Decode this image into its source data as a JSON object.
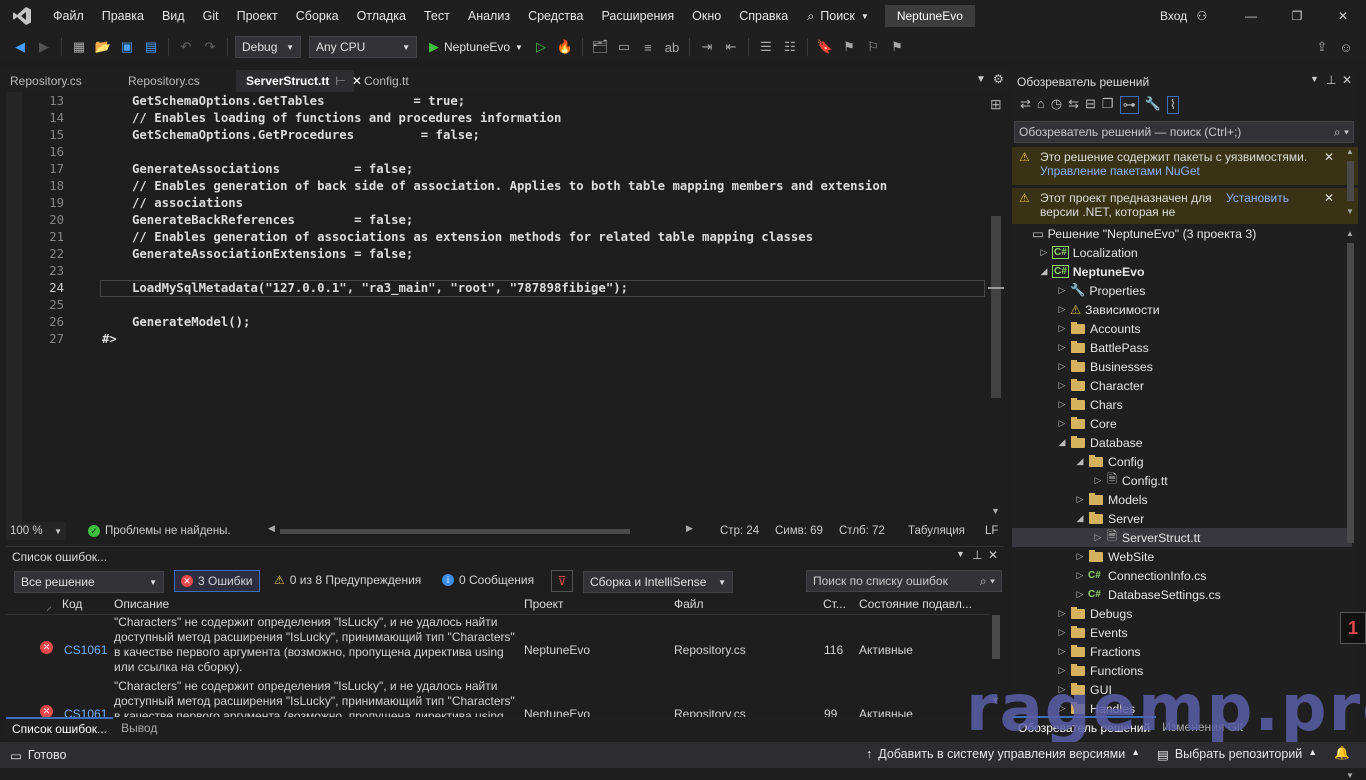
{
  "menu": [
    "Файл",
    "Правка",
    "Вид",
    "Git",
    "Проект",
    "Сборка",
    "Отладка",
    "Тест",
    "Анализ",
    "Средства",
    "Расширения",
    "Окно",
    "Справка"
  ],
  "search_label": "Поиск",
  "project_name": "NeptuneEvo",
  "login": "Вход",
  "toolbar": {
    "config": "Debug",
    "platform": "Any CPU",
    "run_label": "NeptuneEvo"
  },
  "tabs": [
    "Repository.cs",
    "Repository.cs",
    "ServerStruct.tt",
    "Config.tt"
  ],
  "code": [
    {
      "n": "13",
      "t": "GetSchemaOptions.GetTables            = true;"
    },
    {
      "n": "14",
      "t": "// Enables loading of functions and procedures information"
    },
    {
      "n": "15",
      "t": "GetSchemaOptions.GetProcedures         = false;"
    },
    {
      "n": "16",
      "t": ""
    },
    {
      "n": "17",
      "t": "GenerateAssociations          = false;"
    },
    {
      "n": "18",
      "t": "// Enables generation of back side of association. Applies to both table mapping members and extension"
    },
    {
      "n": "19",
      "t": "// associations"
    },
    {
      "n": "20",
      "t": "GenerateBackReferences        = false;"
    },
    {
      "n": "21",
      "t": "// Enables generation of associations as extension methods for related table mapping classes"
    },
    {
      "n": "22",
      "t": "GenerateAssociationExtensions = false;"
    },
    {
      "n": "23",
      "t": ""
    },
    {
      "n": "24",
      "t": "LoadMySqlMetadata(\"127.0.0.1\", \"ra3_main\", \"root\", \"787898fibige\");"
    },
    {
      "n": "25",
      "t": ""
    },
    {
      "n": "26",
      "t": "GenerateModel();"
    },
    {
      "n": "27",
      "t": "#>"
    }
  ],
  "editor_status": {
    "zoom": "100 %",
    "problems": "Проблемы не найдены.",
    "line": "Стр: 24",
    "col": "Симв: 69",
    "colnum": "Стлб: 72",
    "tabs": "Табуляция",
    "eol": "LF"
  },
  "errors": {
    "title": "Список ошибок...",
    "scope": "Все решение",
    "errors_btn": "3 Ошибки",
    "warnings_btn": "0 из 8 Предупреждения",
    "messages_btn": "0 Сообщения",
    "build_filter": "Сборка и IntelliSense",
    "search_placeholder": "Поиск по списку ошибок",
    "columns": [
      "Код",
      "Описание",
      "Проект",
      "Файл",
      "Ст...",
      "Состояние подавл..."
    ],
    "rows": [
      {
        "code": "CS1061",
        "desc": [
          "\"Characters\" не содержит определения \"IsLucky\", и не удалось найти",
          "доступный метод расширения \"IsLucky\", принимающий тип \"Characters\"",
          "в качестве первого аргумента (возможно, пропущена директива using",
          "или ссылка на сборку)."
        ],
        "project": "NeptuneEvo",
        "file": "Repository.cs",
        "line": "116",
        "state": "Активные"
      },
      {
        "code": "CS1061",
        "desc": [
          "\"Characters\" не содержит определения \"IsLucky\", и не удалось найти",
          "доступный метод расширения \"IsLucky\", принимающий тип \"Characters\"",
          "в качестве первого аргумента (возможно, пропущена директива using"
        ],
        "project": "NeptuneEvo",
        "file": "Repository.cs",
        "line": "99",
        "state": "Активные"
      }
    ],
    "bottom_tabs": [
      "Список ошибок...",
      "Вывод"
    ]
  },
  "solution": {
    "title": "Обозреватель решений",
    "search": "Обозреватель решений — поиск (Ctrl+;)",
    "warn1": "Это решение содержит пакеты с уязвимостями.",
    "warn1_link": "Управление пакетами NuGet",
    "warn2a": "Этот проект предназначен для",
    "warn2b": "версии .NET, которая не",
    "warn2_link": "Установить",
    "items": [
      {
        "label": "Решение \"NeptuneEvo\"  (3 проекта 3)",
        "lvl": 0,
        "tw": "",
        "ic": "sol"
      },
      {
        "label": "Localization",
        "lvl": 1,
        "tw": "▷",
        "ic": "cs"
      },
      {
        "label": "NeptuneEvo",
        "lvl": 1,
        "tw": "◢",
        "ic": "cs",
        "bold": true
      },
      {
        "label": "Properties",
        "lvl": 2,
        "tw": "▷",
        "ic": "wrench"
      },
      {
        "label": "Зависимости",
        "lvl": 2,
        "tw": "▷",
        "ic": "dep"
      },
      {
        "label": "Accounts",
        "lvl": 2,
        "tw": "▷",
        "ic": "folder"
      },
      {
        "label": "BattlePass",
        "lvl": 2,
        "tw": "▷",
        "ic": "folder"
      },
      {
        "label": "Businesses",
        "lvl": 2,
        "tw": "▷",
        "ic": "folder"
      },
      {
        "label": "Character",
        "lvl": 2,
        "tw": "▷",
        "ic": "folder"
      },
      {
        "label": "Chars",
        "lvl": 2,
        "tw": "▷",
        "ic": "folder"
      },
      {
        "label": "Core",
        "lvl": 2,
        "tw": "▷",
        "ic": "folder"
      },
      {
        "label": "Database",
        "lvl": 2,
        "tw": "◢",
        "ic": "folder"
      },
      {
        "label": "Config",
        "lvl": 3,
        "tw": "◢",
        "ic": "folder"
      },
      {
        "label": "Config.tt",
        "lvl": 4,
        "tw": "▷",
        "ic": "file"
      },
      {
        "label": "Models",
        "lvl": 3,
        "tw": "▷",
        "ic": "folder"
      },
      {
        "label": "Server",
        "lvl": 3,
        "tw": "◢",
        "ic": "folder"
      },
      {
        "label": "ServerStruct.tt",
        "lvl": 4,
        "tw": "▷",
        "ic": "file",
        "sel": true
      },
      {
        "label": "WebSite",
        "lvl": 3,
        "tw": "▷",
        "ic": "folder"
      },
      {
        "label": "ConnectionInfo.cs",
        "lvl": 3,
        "tw": "▷",
        "ic": "csf"
      },
      {
        "label": "DatabaseSettings.cs",
        "lvl": 3,
        "tw": "▷",
        "ic": "csf"
      },
      {
        "label": "Debugs",
        "lvl": 2,
        "tw": "▷",
        "ic": "folder"
      },
      {
        "label": "Events",
        "lvl": 2,
        "tw": "▷",
        "ic": "folder"
      },
      {
        "label": "Fractions",
        "lvl": 2,
        "tw": "▷",
        "ic": "folder"
      },
      {
        "label": "Functions",
        "lvl": 2,
        "tw": "▷",
        "ic": "folder"
      },
      {
        "label": "GUI",
        "lvl": 2,
        "tw": "▷",
        "ic": "folder"
      },
      {
        "label": "Handles",
        "lvl": 2,
        "tw": "▷",
        "ic": "folder"
      }
    ],
    "bottom_tabs": [
      "Обозреватель решений",
      "Изменения Git"
    ]
  },
  "status": {
    "ready": "Готово",
    "vcs": "Добавить в систему управления версиями",
    "repo": "Выбрать репозиторий"
  },
  "watermark": "ragemp.pro"
}
